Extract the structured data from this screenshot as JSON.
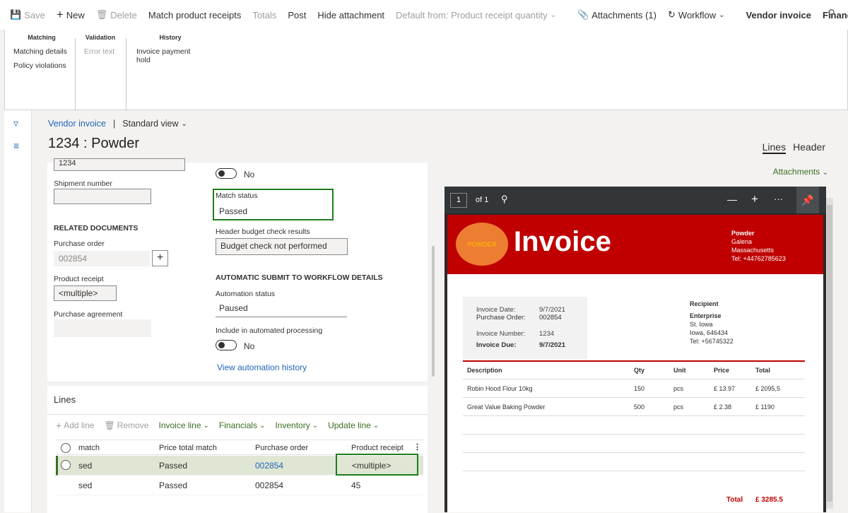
{
  "toolbar": {
    "save": "Save",
    "new": "New",
    "delete": "Delete",
    "match_receipts": "Match product receipts",
    "totals": "Totals",
    "post": "Post",
    "hide_attachment": "Hide attachment",
    "default_from": "Default from: Product receipt quantity",
    "attachments": "Attachments (1)",
    "workflow": "Workflow",
    "vendor_invoice": "Vendor invoice",
    "financials": "Financials"
  },
  "ribbon": {
    "matching": {
      "header": "Matching",
      "items": [
        "Matching details",
        "Policy violations"
      ]
    },
    "validation": {
      "header": "Validation",
      "items": [
        "Error text"
      ]
    },
    "history": {
      "header": "History",
      "items": [
        "Invoice payment hold"
      ]
    }
  },
  "page": {
    "breadcrumb_link": "Vendor invoice",
    "breadcrumb_sep": "|",
    "view": "Standard view",
    "title": "1234 : Powder",
    "tab_lines": "Lines",
    "tab_header": "Header",
    "attachments_link": "Attachments"
  },
  "form": {
    "top_value": "1234",
    "shipment_label": "Shipment number",
    "shipment_value": "",
    "toggle1_label": "No",
    "match_status_label": "Match status",
    "match_status_value": "Passed",
    "related_docs": "RELATED DOCUMENTS",
    "budget_label": "Header budget check results",
    "budget_value": "Budget check not performed",
    "po_label": "Purchase order",
    "po_value": "002854",
    "receipt_label": "Product receipt",
    "receipt_value": "<multiple>",
    "auto_header": "AUTOMATIC SUBMIT TO WORKFLOW DETAILS",
    "automation_label": "Automation status",
    "automation_value": "Paused",
    "agreement_label": "Purchase agreement",
    "include_label": "Include in automated processing",
    "toggle2_label": "No",
    "view_history": "View automation history"
  },
  "lines": {
    "title": "Lines",
    "add_line": "Add line",
    "remove": "Remove",
    "invoice_line": "Invoice line",
    "financials": "Financials",
    "inventory": "Inventory",
    "update_line": "Update line",
    "columns": [
      "match",
      "Price total match",
      "Purchase order",
      "Product receipt"
    ],
    "rows": [
      {
        "match": "sed",
        "price_match": "Passed",
        "po": "002854",
        "receipt": "<multiple>"
      },
      {
        "match": "sed",
        "price_match": "Passed",
        "po": "002854",
        "receipt": "45"
      }
    ]
  },
  "viewer": {
    "page_num": "1",
    "page_of": "of 1",
    "minus": "—",
    "plus": "+",
    "more": "···"
  },
  "invoice": {
    "logo_text": "POWDER",
    "title": "Invoice",
    "company": "Powder",
    "city": "Galena",
    "state": "Massachusetts",
    "tel": "Tel: +44762785623",
    "date_label": "Invoice Date:",
    "date_value": "9/7/2021",
    "po_label": "Purchase Order:",
    "po_value": "002854",
    "num_label": "Invoice Number:",
    "num_value": "1234",
    "due_label": "Invoice Due:",
    "due_value": "9/7/2021",
    "recipient_label": "Recipient",
    "recipient_name": "Enterprise",
    "recipient_street": "St. Iowa",
    "recipient_city": "Iowa, 646434",
    "recipient_tel": "Tel: +56745322",
    "headers": [
      "Description",
      "Qty",
      "Unit",
      "Price",
      "Total"
    ],
    "items": [
      {
        "desc": "Robin Hood Flour 10kg",
        "qty": "150",
        "unit": "pcs",
        "price": "£ 13.97",
        "total": "£ 2095,5"
      },
      {
        "desc": "Great Value Baking Powder",
        "qty": "500",
        "unit": "pcs",
        "price": "£ 2.38",
        "total": "£ 1190"
      }
    ],
    "total_label": "Total",
    "total_value": "£ 3285.5"
  },
  "colors": {
    "accent_green": "#3b6e22",
    "link_blue": "#2266b8",
    "invoice_red": "#c00000",
    "logo_orange": "#ed7d31",
    "highlight_green": "#1e7d1e"
  }
}
